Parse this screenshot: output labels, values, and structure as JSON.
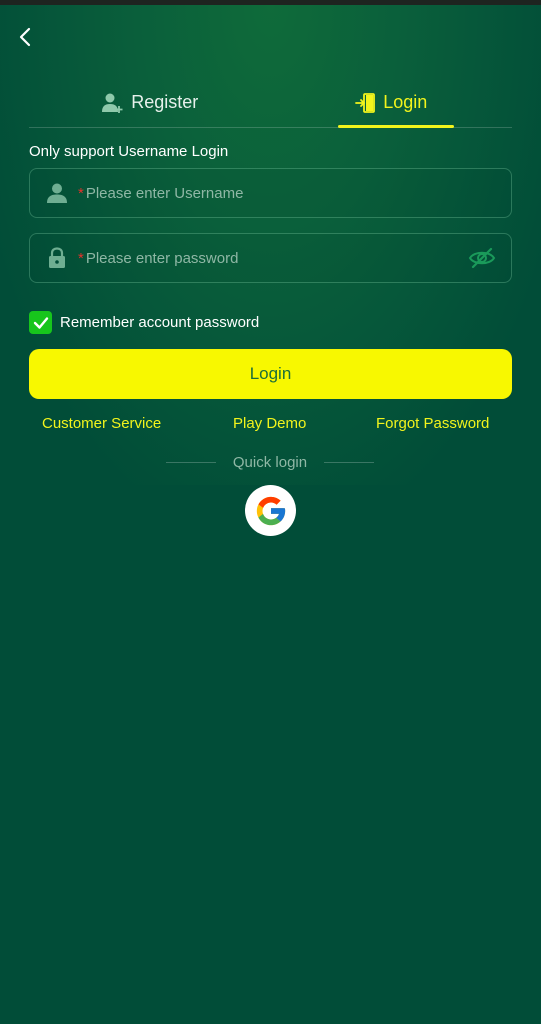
{
  "header": {
    "back_icon": "chevron-left-icon"
  },
  "tabs": [
    {
      "label": "Register",
      "icon": "add-user-icon",
      "active": false
    },
    {
      "label": "Login",
      "icon": "login-door-icon",
      "active": true
    }
  ],
  "form": {
    "hint": "Only support Username Login",
    "username": {
      "required_mark": "*",
      "placeholder": "Please enter Username",
      "value": "",
      "icon": "user-icon"
    },
    "password": {
      "required_mark": "*",
      "placeholder": "Please enter password",
      "value": "",
      "icon": "lock-icon",
      "toggle_icon": "eye-off-icon"
    },
    "remember": {
      "label": "Remember account password",
      "checked": true
    },
    "submit_label": "Login"
  },
  "links": {
    "customer_service": "Customer Service",
    "play_demo": "Play Demo",
    "forgot_password": "Forgot Password"
  },
  "quick_login": {
    "label": "Quick login",
    "providers": [
      "google-icon"
    ]
  },
  "colors": {
    "background": "#014d38",
    "accent_yellow": "#f2f41c",
    "button_yellow": "#f8f800",
    "checkbox_green": "#17c51c",
    "required_red": "#e4322b"
  }
}
